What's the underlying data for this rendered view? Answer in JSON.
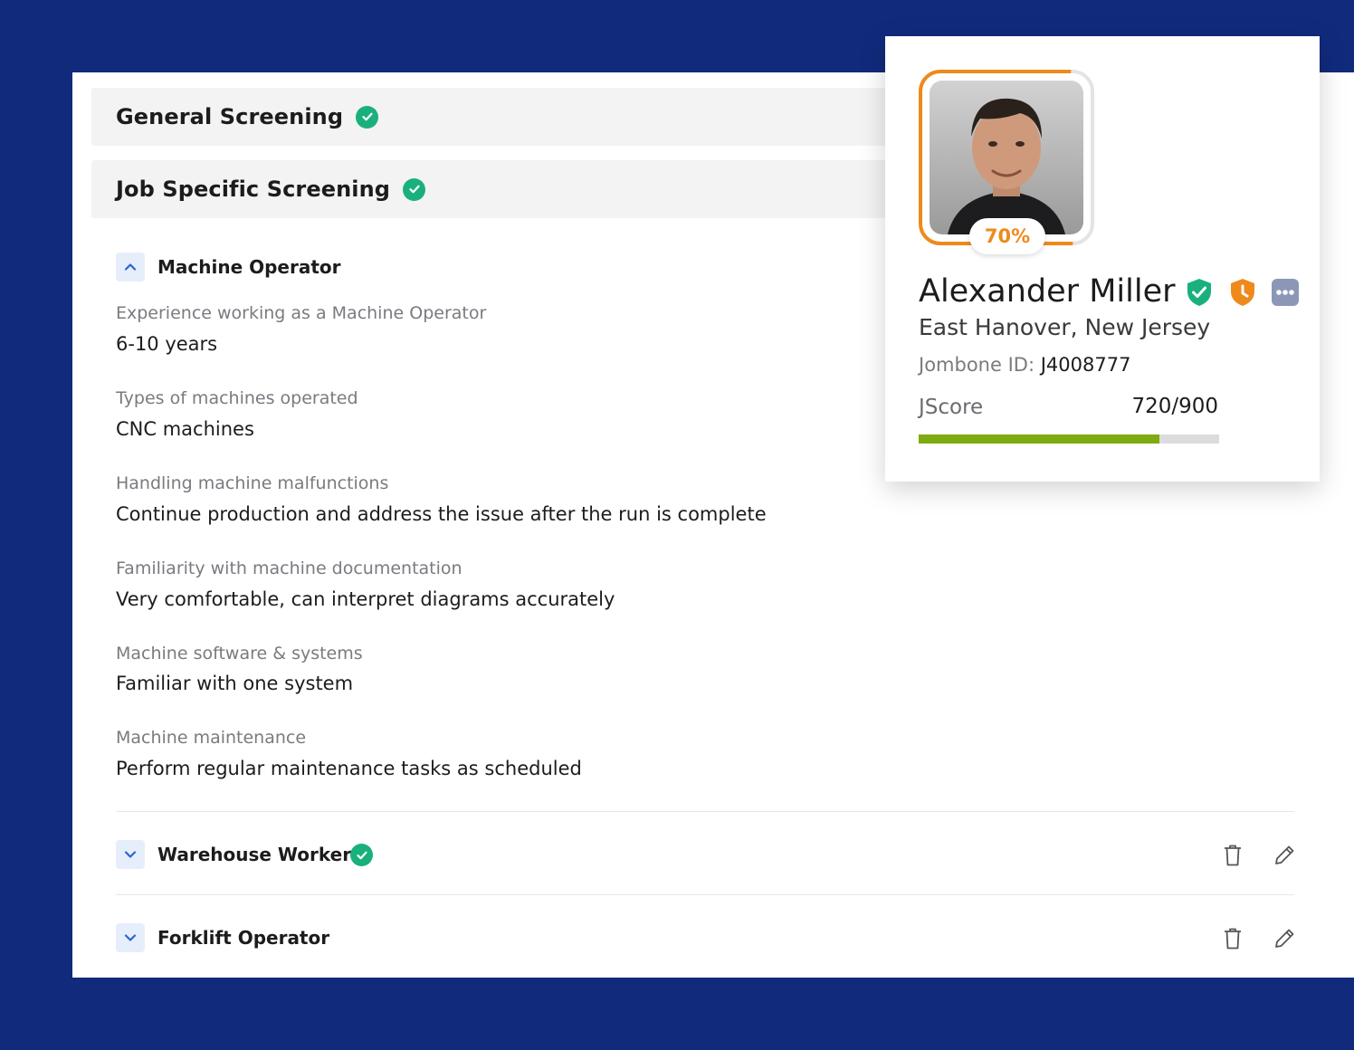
{
  "sections": {
    "general": {
      "title": "General Screening"
    },
    "job_specific": {
      "title": "Job Specific Screening"
    }
  },
  "jobs": [
    {
      "title": "Machine Operator",
      "expanded": true,
      "qa": [
        {
          "q": "Experience working as a Machine Operator",
          "a": "6-10 years"
        },
        {
          "q": "Types of machines operated",
          "a": "CNC machines"
        },
        {
          "q": "Handling machine malfunctions",
          "a": "Continue production and address the issue after the run is complete"
        },
        {
          "q": "Familiarity with machine documentation",
          "a": "Very comfortable, can interpret diagrams accurately"
        },
        {
          "q": "Machine software & systems",
          "a": "Familiar with one system"
        },
        {
          "q": "Machine maintenance",
          "a": "Perform regular maintenance tasks as scheduled"
        }
      ]
    },
    {
      "title": "Warehouse Worker",
      "expanded": false,
      "completed": true
    },
    {
      "title": "Forklift Operator",
      "expanded": false,
      "completed": false
    }
  ],
  "profile": {
    "match_percent": "70%",
    "match_value": 0.7,
    "name": "Alexander Miller",
    "location": "East Hanover, New Jersey",
    "id_label": "Jombone ID:",
    "id_value": "J4008777",
    "jscore_label": "JScore",
    "jscore_value": "720/900",
    "jscore_fraction": 0.8,
    "badges": [
      "verified-shield-icon",
      "pending-shield-icon",
      "more-options-icon"
    ]
  },
  "colors": {
    "background": "#112a7c",
    "check": "#1ab07c",
    "accent_orange": "#ee8a1b",
    "score_bar": "#7eab0f",
    "chevron": "#2a64d6"
  }
}
